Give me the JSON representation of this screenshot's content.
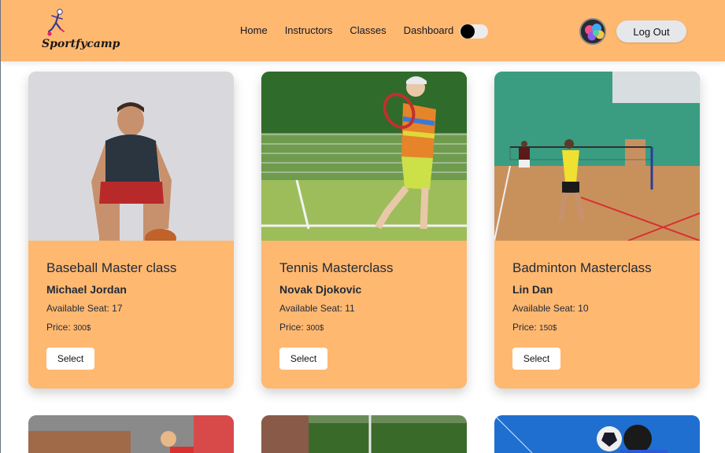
{
  "navbar": {
    "logo_text": "Sportfycamp",
    "links": [
      "Home",
      "Instructors",
      "Classes",
      "Dashboard"
    ],
    "logout_label": "Log Out"
  },
  "classes": [
    {
      "title": "Baseball Master class",
      "instructor": "Michael Jordan",
      "seat_label": "Available Seat: 17",
      "price_label": "Price: ",
      "price_value": "300$",
      "select_label": "Select"
    },
    {
      "title": "Tennis Masterclass",
      "instructor": "Novak Djokovic",
      "seat_label": "Available Seat: 11",
      "price_label": "Price: ",
      "price_value": "300$",
      "select_label": "Select"
    },
    {
      "title": "Badminton Masterclass",
      "instructor": "Lin Dan",
      "seat_label": "Available Seat: 10",
      "price_label": "Price: ",
      "price_value": "150$",
      "select_label": "Select"
    }
  ],
  "colors": {
    "primary": "#ffb870",
    "button": "#ffffff",
    "logout_bg": "#e5e7eb"
  }
}
